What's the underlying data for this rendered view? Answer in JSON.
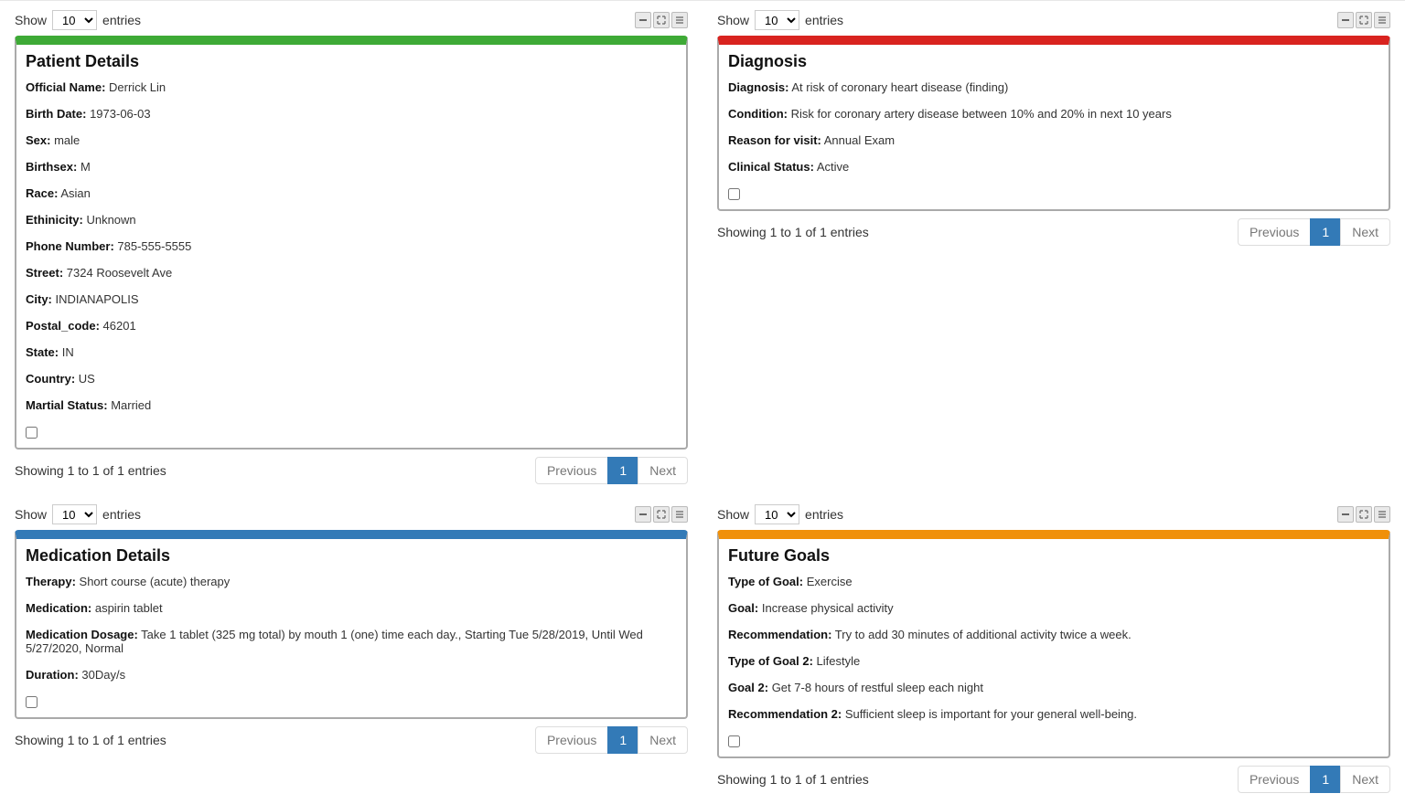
{
  "common": {
    "show": "Show",
    "entries": "entries",
    "select_value": "10",
    "info": "Showing 1 to 1 of 1 entries",
    "prev": "Previous",
    "page1": "1",
    "next": "Next"
  },
  "patient": {
    "title": "Patient Details",
    "fields": [
      {
        "label": "Official Name:",
        "value": "Derrick Lin"
      },
      {
        "label": "Birth Date:",
        "value": "1973-06-03"
      },
      {
        "label": "Sex:",
        "value": "male"
      },
      {
        "label": "Birthsex:",
        "value": "M"
      },
      {
        "label": "Race:",
        "value": "Asian"
      },
      {
        "label": "Ethinicity:",
        "value": "Unknown"
      },
      {
        "label": "Phone Number:",
        "value": "785-555-5555"
      },
      {
        "label": "Street:",
        "value": "7324 Roosevelt Ave"
      },
      {
        "label": "City:",
        "value": "INDIANAPOLIS"
      },
      {
        "label": "Postal_code:",
        "value": "46201"
      },
      {
        "label": "State:",
        "value": "IN"
      },
      {
        "label": "Country:",
        "value": "US"
      },
      {
        "label": "Martial Status:",
        "value": "Married"
      }
    ]
  },
  "diagnosis": {
    "title": "Diagnosis",
    "fields": [
      {
        "label": "Diagnosis:",
        "value": "At risk of coronary heart disease (finding)"
      },
      {
        "label": "Condition:",
        "value": "Risk for coronary artery disease between 10% and 20% in next 10 years"
      },
      {
        "label": "Reason for visit:",
        "value": "Annual Exam"
      },
      {
        "label": "Clinical Status:",
        "value": "Active"
      }
    ]
  },
  "medication": {
    "title": "Medication Details",
    "fields": [
      {
        "label": "Therapy:",
        "value": "Short course (acute) therapy"
      },
      {
        "label": "Medication:",
        "value": "aspirin tablet"
      },
      {
        "label": "Medication Dosage:",
        "value": "Take 1 tablet (325 mg total) by mouth 1 (one) time each day., Starting Tue 5/28/2019, Until Wed 5/27/2020, Normal"
      },
      {
        "label": "Duration:",
        "value": "30Day/s"
      }
    ]
  },
  "goals": {
    "title": "Future Goals",
    "fields": [
      {
        "label": "Type of Goal:",
        "value": "Exercise"
      },
      {
        "label": "Goal:",
        "value": "Increase physical activity"
      },
      {
        "label": "Recommendation:",
        "value": "Try to add 30 minutes of additional activity twice a week."
      },
      {
        "label": "Type of Goal 2:",
        "value": "Lifestyle"
      },
      {
        "label": "Goal 2:",
        "value": "Get 7-8 hours of restful sleep each night"
      },
      {
        "label": "Recommendation 2:",
        "value": "Sufficient sleep is important for your general well-being."
      }
    ]
  }
}
